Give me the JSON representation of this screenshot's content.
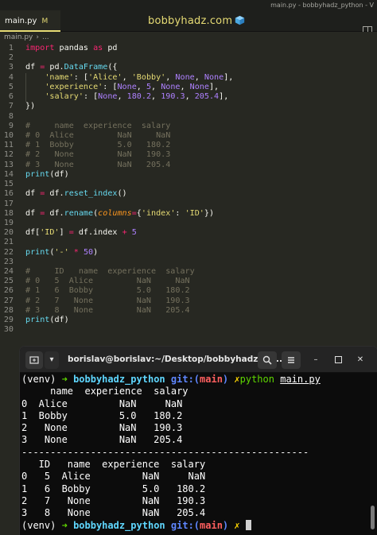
{
  "window": {
    "title": "main.py - bobbyhadz_python - V"
  },
  "tab": {
    "label": "main.py",
    "modified": "M"
  },
  "brand": {
    "text": "bobbyhadz.com",
    "accent": "#e6db74"
  },
  "breadcrumb": {
    "file": "main.py",
    "more": "..."
  },
  "editor": {
    "lines": [
      {
        "n": "1",
        "tokens": [
          [
            "k",
            "import"
          ],
          [
            "w",
            " "
          ],
          [
            "w",
            "pandas"
          ],
          [
            "w",
            " "
          ],
          [
            "k",
            "as"
          ],
          [
            "w",
            " pd"
          ]
        ]
      },
      {
        "n": "2",
        "tokens": []
      },
      {
        "n": "3",
        "tokens": [
          [
            "w",
            "df "
          ],
          [
            "k",
            "="
          ],
          [
            "w",
            " pd."
          ],
          [
            "f",
            "DataFrame"
          ],
          [
            "w",
            "({"
          ]
        ]
      },
      {
        "n": "4",
        "tokens": [
          [
            "w",
            "    "
          ],
          [
            "s",
            "'name'"
          ],
          [
            "w",
            ": ["
          ],
          [
            "s",
            "'Alice'"
          ],
          [
            "w",
            ", "
          ],
          [
            "s",
            "'Bobby'"
          ],
          [
            "w",
            ", "
          ],
          [
            "n",
            "None"
          ],
          [
            "w",
            ", "
          ],
          [
            "n",
            "None"
          ],
          [
            "w",
            "],"
          ]
        ]
      },
      {
        "n": "5",
        "tokens": [
          [
            "w",
            "    "
          ],
          [
            "s",
            "'experience'"
          ],
          [
            "w",
            ": ["
          ],
          [
            "n",
            "None"
          ],
          [
            "w",
            ", "
          ],
          [
            "n",
            "5"
          ],
          [
            "w",
            ", "
          ],
          [
            "n",
            "None"
          ],
          [
            "w",
            ", "
          ],
          [
            "n",
            "None"
          ],
          [
            "w",
            "],"
          ]
        ]
      },
      {
        "n": "6",
        "tokens": [
          [
            "w",
            "    "
          ],
          [
            "s",
            "'salary'"
          ],
          [
            "w",
            ": ["
          ],
          [
            "n",
            "None"
          ],
          [
            "w",
            ", "
          ],
          [
            "n",
            "180.2"
          ],
          [
            "w",
            ", "
          ],
          [
            "n",
            "190.3"
          ],
          [
            "w",
            ", "
          ],
          [
            "n",
            "205.4"
          ],
          [
            "w",
            "],"
          ]
        ]
      },
      {
        "n": "7",
        "tokens": [
          [
            "w",
            "})"
          ]
        ]
      },
      {
        "n": "8",
        "tokens": []
      },
      {
        "n": "9",
        "tokens": [
          [
            "c",
            "#     name  experience  salary"
          ]
        ]
      },
      {
        "n": "10",
        "tokens": [
          [
            "c",
            "# 0  Alice         NaN     NaN"
          ]
        ]
      },
      {
        "n": "11",
        "tokens": [
          [
            "c",
            "# 1  Bobby         5.0   180.2"
          ]
        ]
      },
      {
        "n": "12",
        "tokens": [
          [
            "c",
            "# 2   None         NaN   190.3"
          ]
        ]
      },
      {
        "n": "13",
        "tokens": [
          [
            "c",
            "# 3   None         NaN   205.4"
          ]
        ]
      },
      {
        "n": "14",
        "tokens": [
          [
            "f",
            "print"
          ],
          [
            "w",
            "(df)"
          ]
        ]
      },
      {
        "n": "15",
        "tokens": []
      },
      {
        "n": "16",
        "tokens": [
          [
            "w",
            "df "
          ],
          [
            "k",
            "="
          ],
          [
            "w",
            " df."
          ],
          [
            "f",
            "reset_index"
          ],
          [
            "w",
            "()"
          ]
        ]
      },
      {
        "n": "17",
        "tokens": []
      },
      {
        "n": "18",
        "tokens": [
          [
            "w",
            "df "
          ],
          [
            "k",
            "="
          ],
          [
            "w",
            " df."
          ],
          [
            "f",
            "rename"
          ],
          [
            "w",
            "("
          ],
          [
            "p",
            "columns"
          ],
          [
            "k",
            "="
          ],
          [
            "w",
            "{"
          ],
          [
            "s",
            "'index'"
          ],
          [
            "w",
            ": "
          ],
          [
            "s",
            "'ID'"
          ],
          [
            "w",
            "})"
          ]
        ]
      },
      {
        "n": "19",
        "tokens": []
      },
      {
        "n": "20",
        "tokens": [
          [
            "w",
            "df["
          ],
          [
            "s",
            "'ID'"
          ],
          [
            "w",
            "] "
          ],
          [
            "k",
            "="
          ],
          [
            "w",
            " df.index "
          ],
          [
            "k",
            "+"
          ],
          [
            "w",
            " "
          ],
          [
            "n",
            "5"
          ]
        ]
      },
      {
        "n": "21",
        "tokens": []
      },
      {
        "n": "22",
        "tokens": [
          [
            "f",
            "print"
          ],
          [
            "w",
            "("
          ],
          [
            "s",
            "'-'"
          ],
          [
            "w",
            " "
          ],
          [
            "k",
            "*"
          ],
          [
            "w",
            " "
          ],
          [
            "n",
            "50"
          ],
          [
            "w",
            ")"
          ]
        ]
      },
      {
        "n": "23",
        "tokens": []
      },
      {
        "n": "24",
        "tokens": [
          [
            "c",
            "#     ID   name  experience  salary"
          ]
        ]
      },
      {
        "n": "25",
        "tokens": [
          [
            "c",
            "# 0   5  Alice         NaN     NaN"
          ]
        ]
      },
      {
        "n": "26",
        "tokens": [
          [
            "c",
            "# 1   6  Bobby         5.0   180.2"
          ]
        ]
      },
      {
        "n": "27",
        "tokens": [
          [
            "c",
            "# 2   7   None         NaN   190.3"
          ]
        ]
      },
      {
        "n": "28",
        "tokens": [
          [
            "c",
            "# 3   8   None         NaN   205.4"
          ]
        ]
      },
      {
        "n": "29",
        "tokens": [
          [
            "f",
            "print"
          ],
          [
            "w",
            "(df)"
          ]
        ]
      },
      {
        "n": "30",
        "tokens": []
      }
    ]
  },
  "terminal": {
    "title": "borislav@borislav:~/Desktop/bobbyhadz_py...",
    "prompt1": {
      "venv": "(venv)",
      "arrow": "➜",
      "dir": "bobbyhadz_python",
      "git": "git:(",
      "branch": "main",
      "gitclose": ")",
      "x": "✗",
      "cmd": "python",
      "arg": "main.py"
    },
    "output": [
      "     name  experience  salary",
      "0  Alice         NaN     NaN",
      "1  Bobby         5.0   180.2",
      "2   None         NaN   190.3",
      "3   None         NaN   205.4",
      "--------------------------------------------------",
      "   ID   name  experience  salary",
      "0   5  Alice         NaN     NaN",
      "1   6  Bobby         5.0   180.2",
      "2   7   None         NaN   190.3",
      "3   8   None         NaN   205.4"
    ],
    "prompt2": {
      "venv": "(venv)",
      "arrow": "➜",
      "dir": "bobbyhadz_python",
      "git": "git:(",
      "branch": "main",
      "gitclose": ")",
      "x": "✗"
    }
  }
}
